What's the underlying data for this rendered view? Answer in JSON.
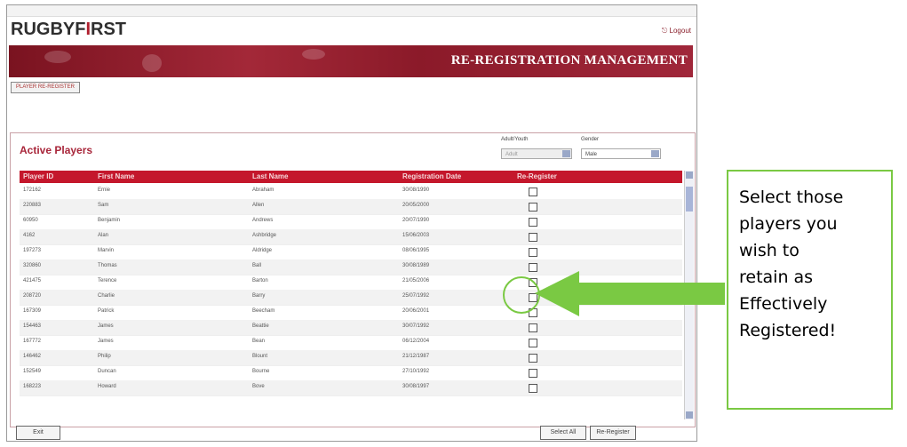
{
  "app": {
    "logo_part1": "RUGBYF",
    "logo_i": "I",
    "logo_part2": "RST",
    "logout_label": "Logout",
    "banner_title": "RE-REGISTRATION MANAGEMENT",
    "small_button_label": "PLAYER RE-REGISTER"
  },
  "panel": {
    "title": "Active Players",
    "filter_adult_youth_label": "Adult/Youth",
    "filter_adult_youth_value": "Adult",
    "filter_gender_label": "Gender",
    "filter_gender_value": "Male"
  },
  "grid": {
    "columns": [
      "Player ID",
      "First Name",
      "Last Name",
      "Registration Date",
      "Re-Register"
    ],
    "rows": [
      {
        "id": "172162",
        "first": "Ernie",
        "last": "Abraham",
        "date": "30/08/1990"
      },
      {
        "id": "220883",
        "first": "Sam",
        "last": "Allen",
        "date": "20/05/2000"
      },
      {
        "id": "60950",
        "first": "Benjamin",
        "last": "Andrews",
        "date": "20/07/1990"
      },
      {
        "id": "4162",
        "first": "Alan",
        "last": "Ashbridge",
        "date": "15/06/2003"
      },
      {
        "id": "197273",
        "first": "Marvin",
        "last": "Aldridge",
        "date": "08/06/1995"
      },
      {
        "id": "320860",
        "first": "Thomas",
        "last": "Ball",
        "date": "30/08/1989"
      },
      {
        "id": "421475",
        "first": "Terence",
        "last": "Barton",
        "date": "21/05/2006"
      },
      {
        "id": "208720",
        "first": "Charlie",
        "last": "Barry",
        "date": "25/07/1992"
      },
      {
        "id": "167309",
        "first": "Patrick",
        "last": "Beecham",
        "date": "20/06/2001"
      },
      {
        "id": "154463",
        "first": "James",
        "last": "Beattie",
        "date": "30/07/1992"
      },
      {
        "id": "167772",
        "first": "James",
        "last": "Bean",
        "date": "06/12/2004"
      },
      {
        "id": "146462",
        "first": "Philip",
        "last": "Blount",
        "date": "21/12/1987"
      },
      {
        "id": "152549",
        "first": "Duncan",
        "last": "Bourne",
        "date": "27/10/1992"
      },
      {
        "id": "168223",
        "first": "Howard",
        "last": "Bove",
        "date": "30/08/1997"
      }
    ]
  },
  "footer": {
    "exit_label": "Exit",
    "select_all_label": "Select All",
    "reregister_label": "Re-Register"
  },
  "callout": {
    "text_lines": [
      "Select those",
      "players you",
      "wish to",
      "retain as",
      "Effectively",
      "Registered!"
    ]
  },
  "colors": {
    "brand_red": "#c4172c",
    "callout_green": "#7ac943"
  }
}
